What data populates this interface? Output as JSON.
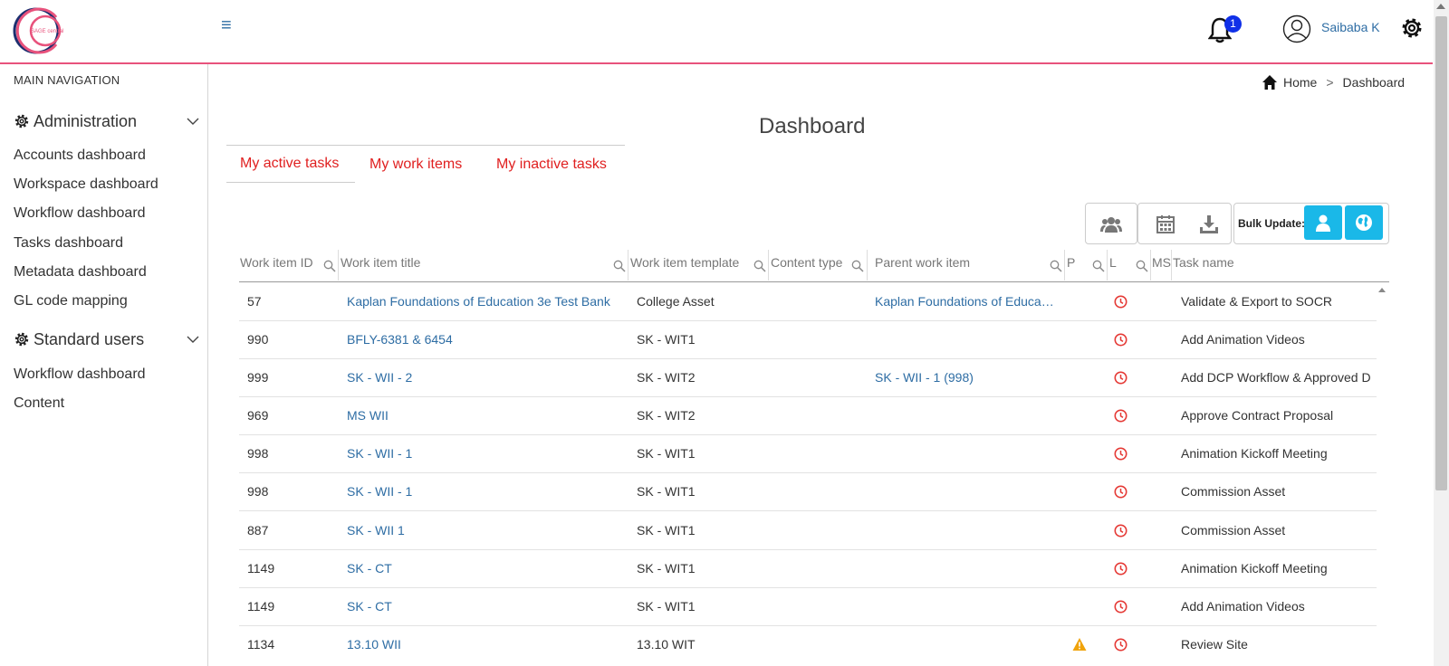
{
  "header": {
    "menu_glyph": "≡",
    "notification_count": "1",
    "username": "Saibaba K",
    "logo_text": "SAGE central"
  },
  "sidebar": {
    "heading": "MAIN NAVIGATION",
    "groups": [
      {
        "label": "Administration",
        "items": [
          "Accounts dashboard",
          "Workspace dashboard",
          "Workflow dashboard",
          "Tasks dashboard",
          "Metadata dashboard",
          "GL code mapping"
        ]
      },
      {
        "label": "Standard users",
        "items": [
          "Workflow dashboard",
          "Content"
        ]
      }
    ]
  },
  "breadcrumb": {
    "home": "Home",
    "separator": ">",
    "current": "Dashboard"
  },
  "page": {
    "title": "Dashboard"
  },
  "tabs": [
    "My active tasks",
    "My work items",
    "My inactive tasks"
  ],
  "toolbar": {
    "bulk_label": "Bulk Update:"
  },
  "table": {
    "columns": [
      "Work item ID",
      "Work item title",
      "Work item template",
      "Content type",
      "Parent work item",
      "P",
      "L",
      "MS",
      "Task name"
    ],
    "rows": [
      {
        "id": "57",
        "title": "Kaplan Foundations of Education 3e Test Bank",
        "template": "College Asset",
        "content_type": "",
        "parent": "Kaplan Foundations of Educa…",
        "p_warning": false,
        "task": "Validate & Export to SOCR"
      },
      {
        "id": "990",
        "title": "BFLY-6381 & 6454",
        "template": "SK - WIT1",
        "content_type": "",
        "parent": "",
        "p_warning": false,
        "task": "Add Animation Videos"
      },
      {
        "id": "999",
        "title": "SK - WII - 2",
        "template": "SK - WIT2",
        "content_type": "",
        "parent": "SK - WII - 1 (998)",
        "p_warning": false,
        "task": "Add DCP Workflow & Approved D"
      },
      {
        "id": "969",
        "title": "MS WII",
        "template": "SK - WIT2",
        "content_type": "",
        "parent": "",
        "p_warning": false,
        "task": "Approve Contract Proposal"
      },
      {
        "id": "998",
        "title": "SK - WII - 1",
        "template": "SK - WIT1",
        "content_type": "",
        "parent": "",
        "p_warning": false,
        "task": "Animation Kickoff Meeting"
      },
      {
        "id": "998",
        "title": "SK - WII - 1",
        "template": "SK - WIT1",
        "content_type": "",
        "parent": "",
        "p_warning": false,
        "task": "Commission Asset"
      },
      {
        "id": "887",
        "title": "SK - WII 1",
        "template": "SK - WIT1",
        "content_type": "",
        "parent": "",
        "p_warning": false,
        "task": "Commission Asset"
      },
      {
        "id": "1149",
        "title": "SK - CT",
        "template": "SK - WIT1",
        "content_type": "",
        "parent": "",
        "p_warning": false,
        "task": "Animation Kickoff Meeting"
      },
      {
        "id": "1149",
        "title": "SK - CT",
        "template": "SK - WIT1",
        "content_type": "",
        "parent": "",
        "p_warning": false,
        "task": "Add Animation Videos"
      },
      {
        "id": "1134",
        "title": "13.10 WII",
        "template": "13.10 WIT",
        "content_type": "",
        "parent": "",
        "p_warning": true,
        "task": "Review Site"
      }
    ]
  },
  "colors": {
    "accent_pink": "#e8527c",
    "link_blue": "#2e6da4",
    "tab_red": "#e02020",
    "bulk_cyan": "#1ab8e8",
    "clock_red": "#e53935",
    "warn_orange": "#f0a30a"
  }
}
